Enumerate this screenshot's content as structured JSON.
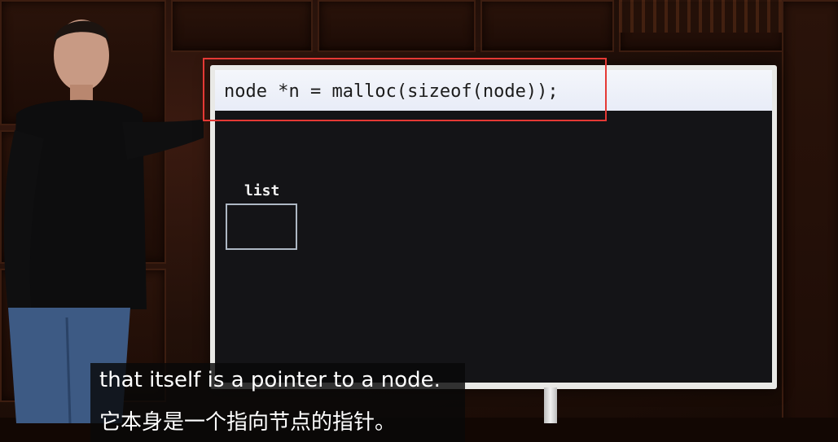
{
  "board": {
    "code_line": "node *n = malloc(sizeof(node));",
    "list_label": "list"
  },
  "subtitles": {
    "english": "that itself is a pointer to a node.",
    "chinese": "它本身是一个指向节点的指针。"
  },
  "colors": {
    "highlight": "#e53935",
    "board_background": "#141417",
    "code_bar": "#eef1f9",
    "list_box_border": "#aeb8c4"
  },
  "icons": {
    "presenter": "presenter-figure"
  }
}
